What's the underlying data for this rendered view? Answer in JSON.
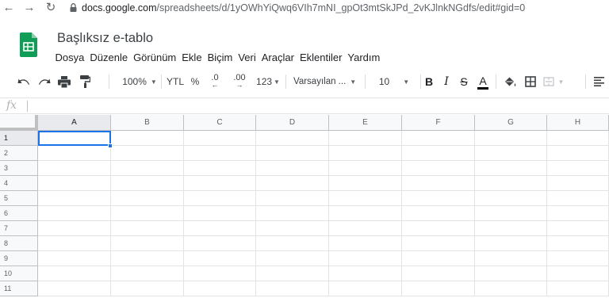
{
  "browser": {
    "back_icon": "←",
    "forward_icon": "→",
    "reload_icon": "↻",
    "url_host": "docs.google.com",
    "url_path": "/spreadsheets/d/1yOWhYiQwq6VIh7mNI_gpOt3mtSkJPd_2vKJlnkNGdfs/edit#gid=0"
  },
  "sheets": {
    "title": "Başlıksız e-tablo",
    "menu": [
      "Dosya",
      "Düzenle",
      "Görünüm",
      "Ekle",
      "Biçim",
      "Veri",
      "Araçlar",
      "Eklentiler",
      "Yardım"
    ]
  },
  "toolbar": {
    "zoom": "100%",
    "currency": "YTL",
    "percent": "%",
    "decrease_decimal": ".0",
    "increase_decimal": ".00",
    "more_formats": "123",
    "font": "Varsayılan ...",
    "font_size": "10",
    "bold": "B",
    "italic": "I",
    "strikethrough": "S",
    "text_color": "A",
    "text_color_value": "#000000"
  },
  "formula_bar": {
    "fx_label": "fx",
    "value": ""
  },
  "grid": {
    "columns": [
      "A",
      "B",
      "C",
      "D",
      "E",
      "F",
      "G",
      "H"
    ],
    "rows": [
      "1",
      "2",
      "3",
      "4",
      "5",
      "6",
      "7",
      "8",
      "9",
      "10",
      "11"
    ],
    "selected_cell": "A1"
  },
  "colors": {
    "selection": "#1a73e8",
    "sheets_green": "#0f9d58",
    "header_bg": "#f8f9fa",
    "gridline": "#e2e3e3"
  }
}
